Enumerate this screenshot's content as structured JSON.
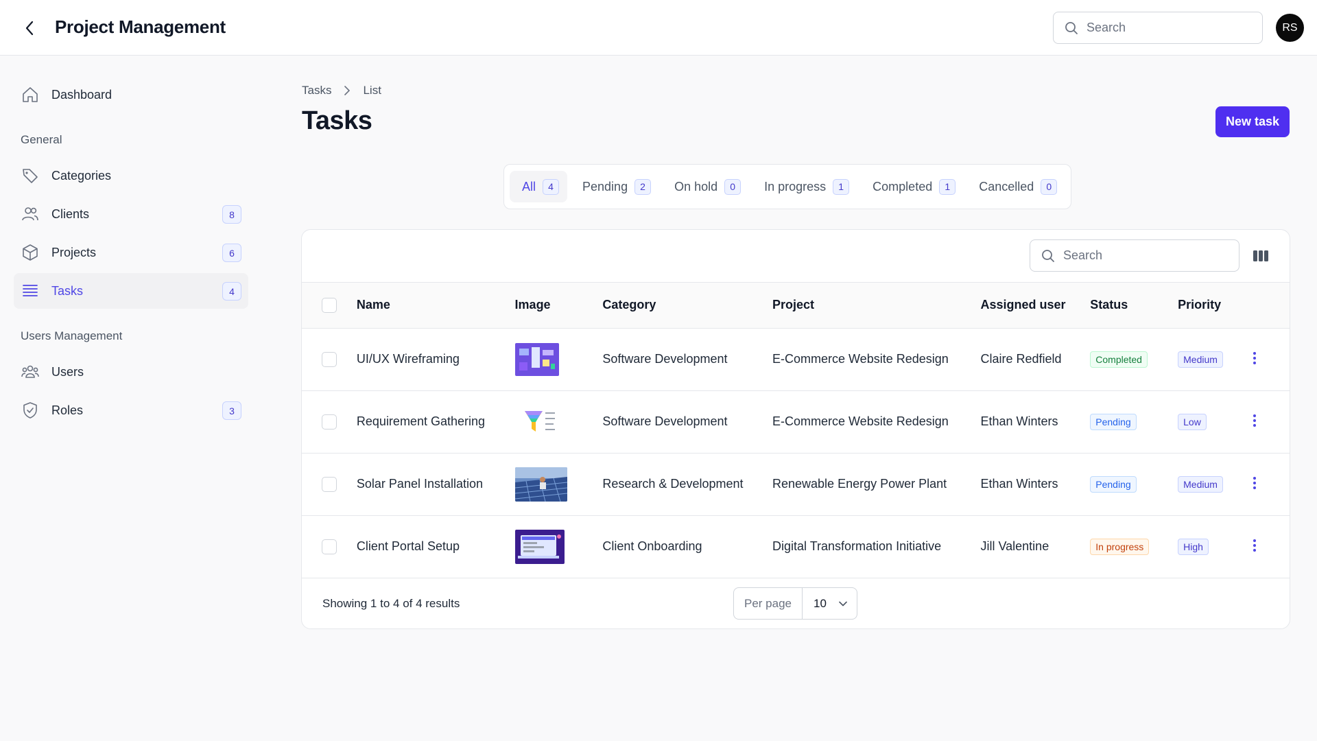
{
  "app": {
    "title": "Project Management"
  },
  "header": {
    "search_placeholder": "Search",
    "avatar_initials": "RS"
  },
  "sidebar": {
    "dashboard": {
      "label": "Dashboard"
    },
    "general_label": "General",
    "general": [
      {
        "label": "Categories",
        "badge": ""
      },
      {
        "label": "Clients",
        "badge": "8"
      },
      {
        "label": "Projects",
        "badge": "6"
      },
      {
        "label": "Tasks",
        "badge": "4"
      }
    ],
    "users_label": "Users Management",
    "users": [
      {
        "label": "Users",
        "badge": ""
      },
      {
        "label": "Roles",
        "badge": "3"
      }
    ]
  },
  "breadcrumb": [
    "Tasks",
    "List"
  ],
  "page": {
    "title": "Tasks",
    "new_button": "New task"
  },
  "tabs": [
    {
      "label": "All",
      "count": "4"
    },
    {
      "label": "Pending",
      "count": "2"
    },
    {
      "label": "On hold",
      "count": "0"
    },
    {
      "label": "In progress",
      "count": "1"
    },
    {
      "label": "Completed",
      "count": "1"
    },
    {
      "label": "Cancelled",
      "count": "0"
    }
  ],
  "table": {
    "search_placeholder": "Search",
    "columns": [
      "Name",
      "Image",
      "Category",
      "Project",
      "Assigned user",
      "Status",
      "Priority"
    ],
    "rows": [
      {
        "name": "UI/UX Wireframing",
        "category": "Software Development",
        "project": "E-Commerce Website Redesign",
        "user": "Claire Redfield",
        "status": "Completed",
        "priority": "Medium"
      },
      {
        "name": "Requirement Gathering",
        "category": "Software Development",
        "project": "E-Commerce Website Redesign",
        "user": "Ethan Winters",
        "status": "Pending",
        "priority": "Low"
      },
      {
        "name": "Solar Panel Installation",
        "category": "Research & Development",
        "project": "Renewable Energy Power Plant",
        "user": "Ethan Winters",
        "status": "Pending",
        "priority": "Medium"
      },
      {
        "name": "Client Portal Setup",
        "category": "Client Onboarding",
        "project": "Digital Transformation Initiative",
        "user": "Jill Valentine",
        "status": "In progress",
        "priority": "High"
      }
    ],
    "footer": {
      "showing": "Showing 1 to 4 of 4 results",
      "per_page_label": "Per page",
      "per_page_value": "10"
    }
  },
  "colors": {
    "accent": "#4f2ff0",
    "active_text": "#4f46e5"
  }
}
